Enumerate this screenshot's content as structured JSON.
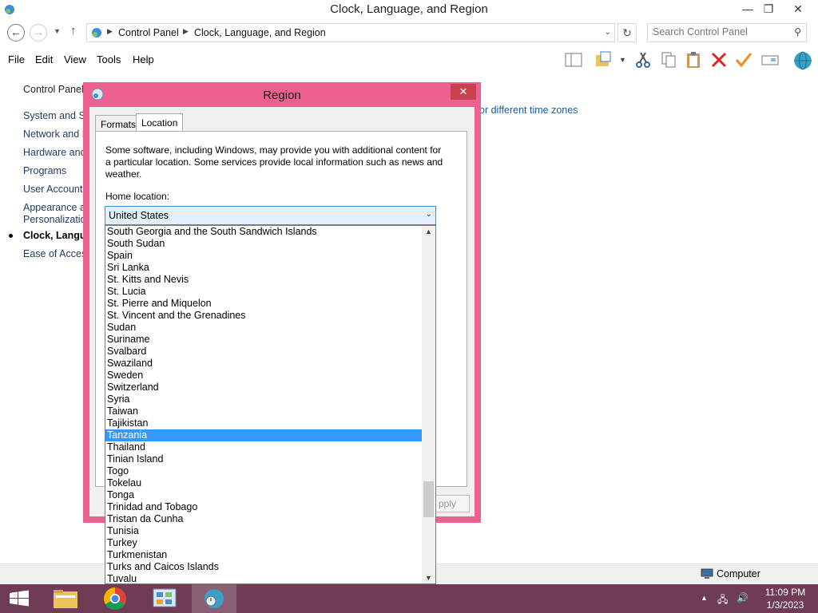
{
  "window": {
    "title": "Clock, Language, and Region",
    "min_glyph": "—",
    "restore_glyph": "❐",
    "close_glyph": "✕"
  },
  "address": {
    "crumbs": [
      "Control Panel",
      "Clock, Language, and Region"
    ],
    "search_placeholder": "Search Control Panel"
  },
  "menu": [
    "File",
    "Edit",
    "View",
    "Tools",
    "Help"
  ],
  "left_nav": {
    "header": "Control Panel",
    "items": [
      "System and Se",
      "Network and I",
      "Hardware and",
      "Programs",
      "User Accounts",
      "Appearance ar",
      "Personalizatio",
      "Clock, Langua",
      "Ease of Access"
    ]
  },
  "main": {
    "partial_link": "or different time zones"
  },
  "dialog": {
    "title": "Region",
    "tabs": [
      "Formats",
      "Location"
    ],
    "active_tab": "Location",
    "description": "Some software, including Windows, may provide you with additional content for a particular location. Some services provide local information such as news and weather.",
    "home_label": "Home location:",
    "home_value": "United States",
    "apply_label": "pply"
  },
  "dropdown": {
    "options": [
      "South Georgia and the South Sandwich Islands",
      "South Sudan",
      "Spain",
      "Sri Lanka",
      "St. Kitts and Nevis",
      "St. Lucia",
      "St. Pierre and Miquelon",
      "St. Vincent and the Grenadines",
      "Sudan",
      "Suriname",
      "Svalbard",
      "Swaziland",
      "Sweden",
      "Switzerland",
      "Syria",
      "Taiwan",
      "Tajikistan",
      "Tanzania",
      "Thailand",
      "Tinian Island",
      "Togo",
      "Tokelau",
      "Tonga",
      "Trinidad and Tobago",
      "Tristan da Cunha",
      "Tunisia",
      "Turkey",
      "Turkmenistan",
      "Turks and Caicos Islands",
      "Tuvalu"
    ],
    "selected": "Tanzania",
    "scroll_position": 0.82
  },
  "status": {
    "computer_label": "Computer"
  },
  "taskbar": {
    "time": "11:09 PM",
    "date": "1/3/2023"
  },
  "colors": {
    "dialog_border": "#ec6190",
    "selection": "#3399ff",
    "taskbar": "#6e3c55"
  }
}
